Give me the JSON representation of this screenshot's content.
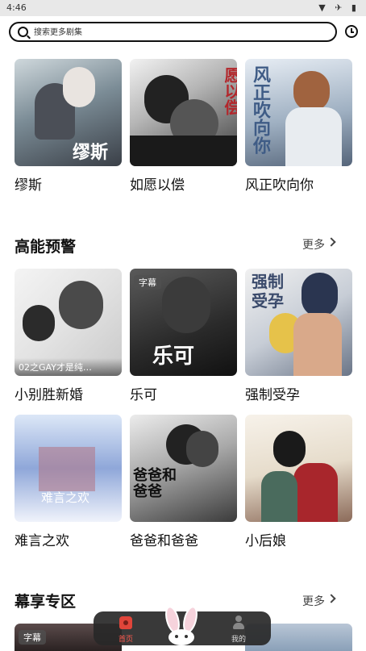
{
  "status_bar": {
    "time": "4:46",
    "icons": "▼ ✈ ▮"
  },
  "search": {
    "placeholder": "搜索更多剧集"
  },
  "top_row": [
    {
      "title": "缪斯",
      "cover_text": "缪斯"
    },
    {
      "title": "如愿以偿",
      "cover_text": "愿以偿"
    },
    {
      "title": "风正吹向你",
      "cover_text": "风正吹向你"
    }
  ],
  "section_warning": {
    "title": "高能预警",
    "more": "更多",
    "items": [
      {
        "title": "小别胜新婚",
        "overlay": "02之GAY才是纯…",
        "badge": ""
      },
      {
        "title": "乐可",
        "badge": "字幕",
        "cover_text": "乐可"
      },
      {
        "title": "强制受孕",
        "cover_text": "强制受孕"
      },
      {
        "title": "难言之欢",
        "cover_text": "难言之欢"
      },
      {
        "title": "爸爸和爸爸",
        "cover_text": "爸爸和爸爸"
      },
      {
        "title": "小后娘"
      }
    ]
  },
  "section_enjoy": {
    "title": "幕享专区",
    "more": "更多",
    "first_badge": "字幕"
  },
  "tabbar": {
    "home": "首页",
    "me": "我的"
  },
  "colors": {
    "accent": "#ff5a4e",
    "tabbar_bg": "#282828"
  }
}
